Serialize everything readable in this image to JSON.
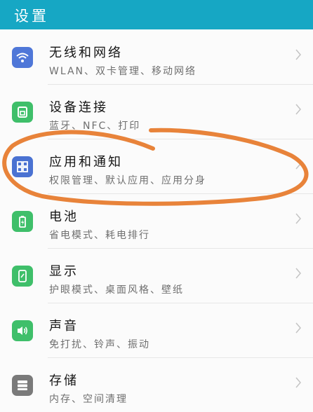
{
  "header": {
    "title": "设置"
  },
  "colors": {
    "header": "#16a7c4",
    "wlan_icon": "#4f77d8",
    "device_icon": "#3fbf6a",
    "apps_icon": "#4a72d2",
    "battery_icon": "#3fbf6a",
    "display_icon": "#3fbf6a",
    "sound_icon": "#3fbf6a",
    "storage_icon": "#7a7a7a",
    "annotation": "#e8833a"
  },
  "items": [
    {
      "title": "无线和网络",
      "subtitle": "WLAN、双卡管理、移动网络",
      "icon": "wifi-icon"
    },
    {
      "title": "设备连接",
      "subtitle": "蓝牙、NFC、打印",
      "icon": "device-connect-icon"
    },
    {
      "title": "应用和通知",
      "subtitle": "权限管理、默认应用、应用分身",
      "icon": "apps-grid-icon"
    },
    {
      "title": "电池",
      "subtitle": "省电模式、耗电排行",
      "icon": "battery-icon"
    },
    {
      "title": "显示",
      "subtitle": "护眼模式、桌面风格、壁纸",
      "icon": "display-icon"
    },
    {
      "title": "声音",
      "subtitle": "免打扰、铃声、振动",
      "icon": "speaker-icon"
    },
    {
      "title": "存储",
      "subtitle": "内存、空间清理",
      "icon": "storage-icon"
    }
  ]
}
